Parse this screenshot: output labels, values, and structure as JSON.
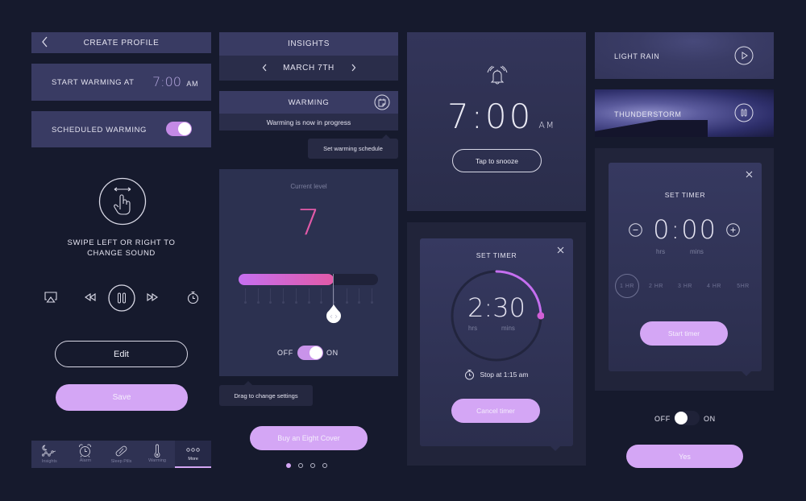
{
  "colors": {
    "background": "#161a2d",
    "panel": "#2b2f4f",
    "accent_lavender": "#d4a6f5",
    "accent_pink": "#e25aa8",
    "accent_purple": "#c56ff0"
  },
  "profile": {
    "title": "CREATE PROFILE",
    "back_icon": "chevron-left-icon",
    "start_warming_label": "START WARMING AT",
    "start_warming_time": "7:00",
    "start_warming_ampm": "AM",
    "scheduled_warming_label": "SCHEDULED WARMING",
    "scheduled_warming_on": true
  },
  "player": {
    "swipe_text_line1": "SWIPE LEFT OR RIGHT TO",
    "swipe_text_line2": "CHANGE SOUND",
    "controls": [
      "airplay-icon",
      "rewind-icon",
      "pause-icon",
      "fast-forward-icon",
      "stopwatch-icon"
    ]
  },
  "buttons": {
    "edit": "Edit",
    "save": "Save",
    "buy_cover": "Buy an Eight Cover",
    "snooze": "Tap to snooze",
    "cancel_timer": "Cancel timer",
    "start_timer": "Start timer",
    "yes": "Yes"
  },
  "tabbar": {
    "items": [
      {
        "label": "Insights",
        "icon": "insights-icon",
        "active": false
      },
      {
        "label": "Alarm",
        "icon": "alarm-clock-icon",
        "active": false
      },
      {
        "label": "Sleep Pills",
        "icon": "pill-icon",
        "active": false
      },
      {
        "label": "Warming",
        "icon": "thermometer-icon",
        "active": false
      },
      {
        "label": "More",
        "icon": "more-icon",
        "active": true
      }
    ]
  },
  "insights": {
    "title": "INSIGHTS",
    "date": "MARCH 7TH",
    "warming_title": "WARMING",
    "warming_status": "Warming is now in progress",
    "tooltip_schedule": "Set warming schedule"
  },
  "level": {
    "label": "Current level",
    "value": "7",
    "slider_fraction": 0.7,
    "tick_count": 11,
    "off_label": "OFF",
    "on_label": "ON",
    "toggle_on": true,
    "tooltip_drag": "Drag to change settings"
  },
  "pagination": {
    "count": 4,
    "active_index": 0
  },
  "alarm": {
    "time": "7:00",
    "ampm": "AM"
  },
  "timer_running": {
    "title": "SET TIMER",
    "time_hours": "2",
    "time_minutes": "30",
    "hrs_label": "hrs",
    "mins_label": "mins",
    "progress_fraction": 0.25,
    "stop_text": "Stop at 1:15 am"
  },
  "sounds": [
    {
      "name": "LIGHT RAIN",
      "state": "play"
    },
    {
      "name": "THUNDERSTORM",
      "state": "pause"
    }
  ],
  "timer_set": {
    "title": "SET TIMER",
    "time_hours": "0",
    "time_minutes": "00",
    "hrs_label": "hrs",
    "mins_label": "mins",
    "presets": [
      "1 HR",
      "2 HR",
      "3 HR",
      "4 HR",
      "5HR"
    ],
    "selected_preset": 0
  },
  "bottom_toggle": {
    "off_label": "OFF",
    "on_label": "ON",
    "toggle_on": false
  }
}
